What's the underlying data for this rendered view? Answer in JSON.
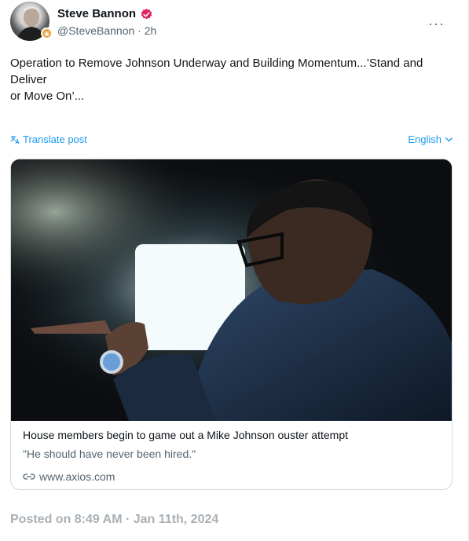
{
  "author": {
    "name": "Steve Bannon",
    "handle": "@SteveBannon",
    "separator": "·",
    "time": "2h",
    "verified_color": "#e0245e"
  },
  "post": {
    "text": "Operation to Remove Johnson Underway and Building Momentum...’Stand and\nDeliver\nor Move On’..."
  },
  "actions": {
    "translate_label": "Translate post",
    "language_label": "English",
    "more_label": "···",
    "accent": "#1d9bf0"
  },
  "card": {
    "title": "House members begin to game out a Mike Johnson ouster attempt",
    "description": "\"He should have never been hired.\"",
    "domain": "www.axios.com"
  },
  "footer": {
    "posted": "Posted on 8:49 AM · Jan 11th, 2024"
  },
  "icons": [
    "avatar",
    "verified-badge-icon",
    "more-icon",
    "translate-icon",
    "chevron-down-icon",
    "link-icon"
  ]
}
